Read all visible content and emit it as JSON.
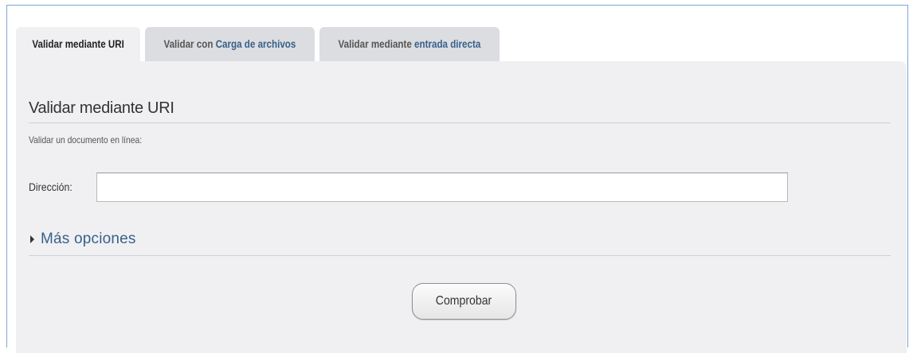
{
  "tabs": [
    {
      "label_plain": "Validar mediante URI",
      "label_highlight": "",
      "active": true
    },
    {
      "label_plain": "Validar con ",
      "label_highlight": "Carga de archivos",
      "active": false
    },
    {
      "label_plain": "Validar mediante ",
      "label_highlight": "entrada directa",
      "active": false
    }
  ],
  "panel": {
    "title": "Validar mediante URI",
    "description": "Validar un documento en línea:",
    "address_label": "Dirección:",
    "address_value": "",
    "more_options_label": "Más opciones",
    "submit_label": "Comprobar"
  },
  "colors": {
    "frame_border": "#7aa7d6",
    "panel_bg": "#f0f0f2",
    "tab_inactive_bg": "#dcdde0",
    "link_blue": "#38618c"
  },
  "icons": {
    "more_options_toggle": "triangle-right-icon"
  }
}
